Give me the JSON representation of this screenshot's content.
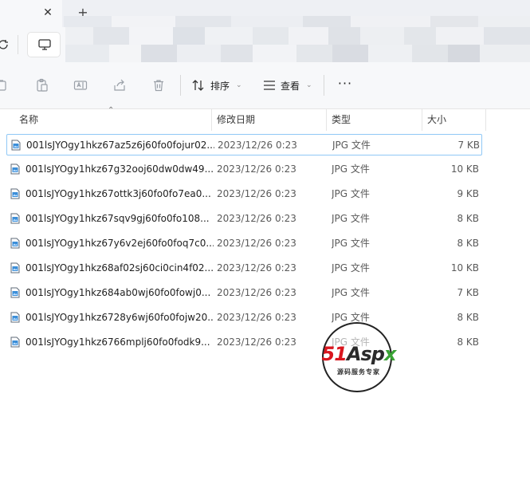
{
  "tabstrip": {
    "close_glyph": "✕",
    "new_tab_glyph": "+"
  },
  "toolbar": {
    "sort_label": "排序",
    "view_label": "查看",
    "more_label": "···"
  },
  "columns": {
    "name": "名称",
    "date": "修改日期",
    "type": "类型",
    "size": "大小"
  },
  "files": [
    {
      "name": "001lsJYOgy1hkz67az5z6j60fo0fojur02...",
      "date": "2023/12/26 0:23",
      "type": "JPG 文件",
      "size": "7 KB"
    },
    {
      "name": "001lsJYOgy1hkz67g32ooj60dw0dw49...",
      "date": "2023/12/26 0:23",
      "type": "JPG 文件",
      "size": "10 KB"
    },
    {
      "name": "001lsJYOgy1hkz67ottk3j60fo0fo7ea0...",
      "date": "2023/12/26 0:23",
      "type": "JPG 文件",
      "size": "9 KB"
    },
    {
      "name": "001lsJYOgy1hkz67sqv9gj60fo0fo108...",
      "date": "2023/12/26 0:23",
      "type": "JPG 文件",
      "size": "8 KB"
    },
    {
      "name": "001lsJYOgy1hkz67y6v2ej60fo0foq7c0...",
      "date": "2023/12/26 0:23",
      "type": "JPG 文件",
      "size": "8 KB"
    },
    {
      "name": "001lsJYOgy1hkz68af02sj60ci0cin4f02...",
      "date": "2023/12/26 0:23",
      "type": "JPG 文件",
      "size": "10 KB"
    },
    {
      "name": "001lsJYOgy1hkz684ab0wj60fo0fowj0...",
      "date": "2023/12/26 0:23",
      "type": "JPG 文件",
      "size": "7 KB"
    },
    {
      "name": "001lsJYOgy1hkz6728y6wj60fo0fojw20...",
      "date": "2023/12/26 0:23",
      "type": "JPG 文件",
      "size": "8 KB"
    },
    {
      "name": "001lsJYOgy1hkz6766mplj60fo0fodk9...",
      "date": "2023/12/26 0:23",
      "type": "JPG 文件",
      "size": "8 KB"
    }
  ],
  "watermark": {
    "brand_51": "51",
    "brand_asp": "Asp",
    "brand_x": "x",
    "tagline": "源码服务专家"
  },
  "colors": {
    "selection_border": "#90c8f6",
    "accent_blue": "#0067c0",
    "brand_red": "#d9161e",
    "brand_green": "#3aa335"
  }
}
